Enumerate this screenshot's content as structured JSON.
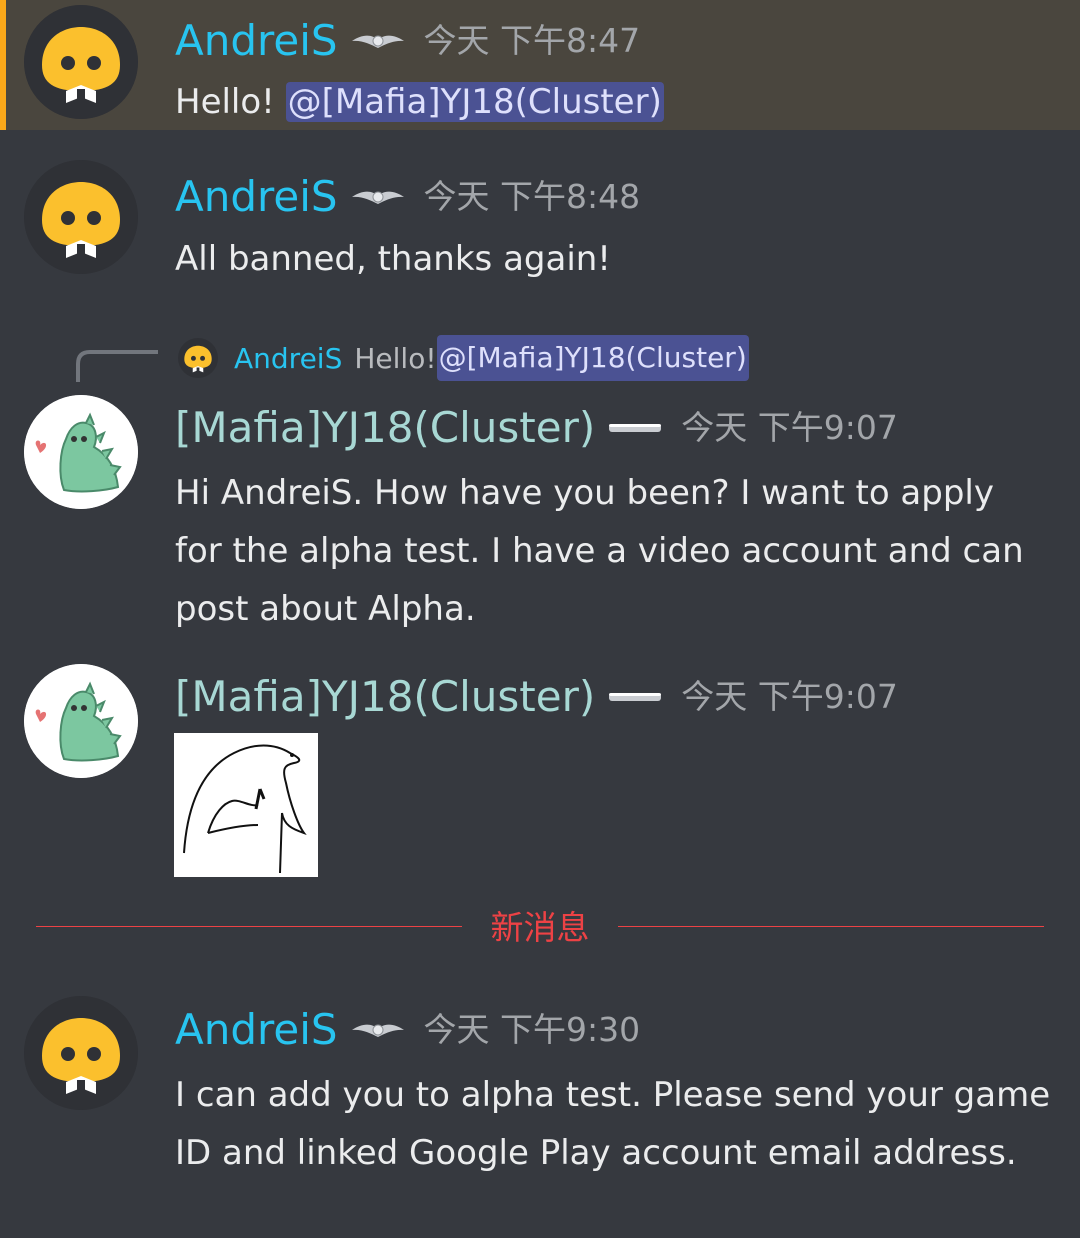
{
  "messages": [
    {
      "author": "AndreiS",
      "time": "今天 下午8:47",
      "text_prefix": "Hello! ",
      "mention": "@[Mafia]YJ18(Cluster)"
    },
    {
      "author": "AndreiS",
      "time": "今天 下午8:48",
      "text": "All banned, thanks again!"
    },
    {
      "reply": {
        "author": "AndreiS",
        "text_prefix": "Hello! ",
        "mention": "@[Mafia]YJ18(Cluster)"
      },
      "author": "[Mafia]YJ18(Cluster)",
      "time": "今天 下午9:07",
      "lines": [
        "Hi AndreiS. How have you been? I want to apply",
        "for the alpha test. I have a video account and can",
        "post about Alpha."
      ]
    },
    {
      "author": "[Mafia]YJ18(Cluster)",
      "time": "今天 下午9:07",
      "attachment": "drawing-image"
    },
    {
      "author": "AndreiS",
      "time": "今天 下午9:30",
      "lines": [
        "I can add you to alpha test. Please send your game",
        "ID and linked Google Play account email address."
      ]
    }
  ],
  "divider": {
    "label": "新消息"
  },
  "colors": {
    "background": "#36393f",
    "author_andreis": "#28c4f0",
    "author_mafia": "#a8d8d4",
    "mention_bg": "#4b5293",
    "new_divider": "#ed4245",
    "highlight_bar": "#faa81a"
  },
  "icons": {
    "badge_andreis": "winged-badge-icon",
    "badge_mafia": "silver-bar-badge-icon",
    "avatar_andreis": "discord-bot-avatar",
    "avatar_mafia": "green-dinosaur-avatar"
  }
}
